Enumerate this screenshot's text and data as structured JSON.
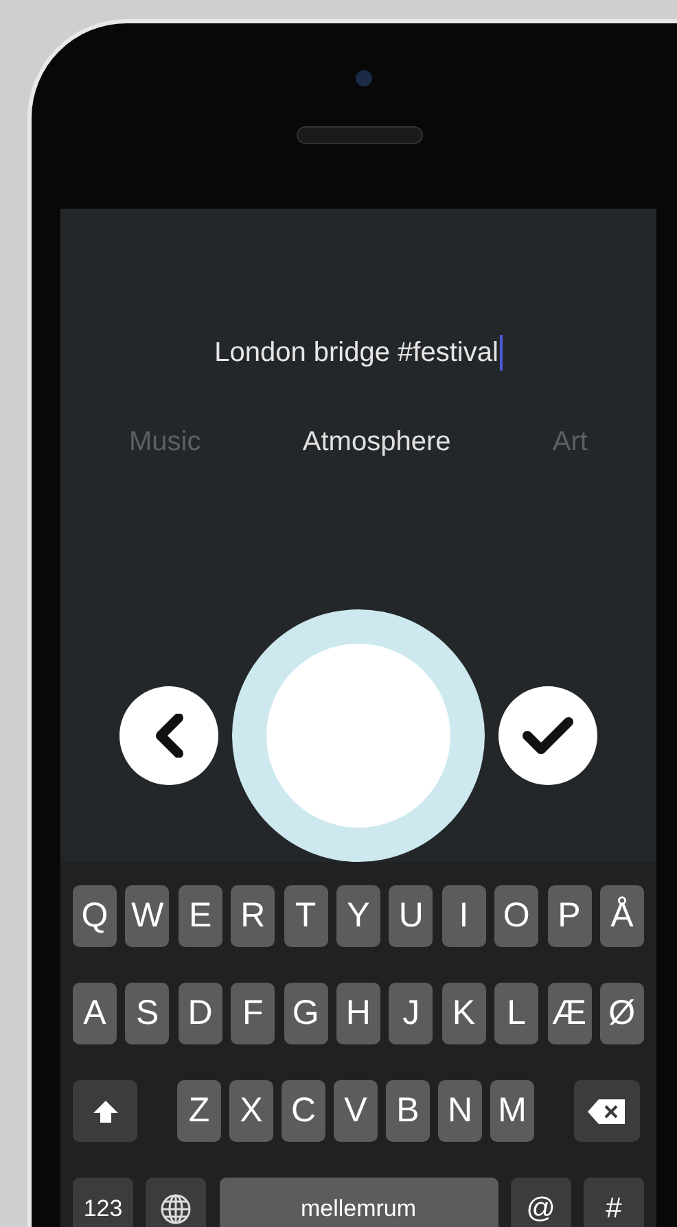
{
  "caption_field": {
    "value": "London bridge #festival",
    "focused": true
  },
  "categories": [
    {
      "label": "Music",
      "selected": false
    },
    {
      "label": "Atmosphere",
      "selected": true
    },
    {
      "label": "Art",
      "selected": false
    }
  ],
  "keyboard": {
    "rows": [
      {
        "keys": [
          {
            "kind": "letter",
            "label": "Q"
          },
          {
            "kind": "letter",
            "label": "W"
          },
          {
            "kind": "letter",
            "label": "E"
          },
          {
            "kind": "letter",
            "label": "R"
          },
          {
            "kind": "letter",
            "label": "T"
          },
          {
            "kind": "letter",
            "label": "Y"
          },
          {
            "kind": "letter",
            "label": "U"
          },
          {
            "kind": "letter",
            "label": "I"
          },
          {
            "kind": "letter",
            "label": "O"
          },
          {
            "kind": "letter",
            "label": "P"
          },
          {
            "kind": "letter",
            "label": "Å"
          }
        ]
      },
      {
        "keys": [
          {
            "kind": "letter",
            "label": "A"
          },
          {
            "kind": "letter",
            "label": "S"
          },
          {
            "kind": "letter",
            "label": "D"
          },
          {
            "kind": "letter",
            "label": "F"
          },
          {
            "kind": "letter",
            "label": "G"
          },
          {
            "kind": "letter",
            "label": "H"
          },
          {
            "kind": "letter",
            "label": "J"
          },
          {
            "kind": "letter",
            "label": "K"
          },
          {
            "kind": "letter",
            "label": "L"
          },
          {
            "kind": "letter",
            "label": "Æ"
          },
          {
            "kind": "letter",
            "label": "Ø"
          }
        ]
      },
      {
        "keys": [
          {
            "kind": "shift"
          },
          {
            "kind": "letter",
            "label": "Z"
          },
          {
            "kind": "letter",
            "label": "X"
          },
          {
            "kind": "letter",
            "label": "C"
          },
          {
            "kind": "letter",
            "label": "V"
          },
          {
            "kind": "letter",
            "label": "B"
          },
          {
            "kind": "letter",
            "label": "N"
          },
          {
            "kind": "letter",
            "label": "M"
          },
          {
            "kind": "backspace"
          }
        ]
      },
      {
        "keys": [
          {
            "kind": "numbers",
            "label": "123"
          },
          {
            "kind": "globe"
          },
          {
            "kind": "space",
            "label": "mellemrum"
          },
          {
            "kind": "symbol",
            "label": "@"
          },
          {
            "kind": "symbol",
            "label": "#"
          }
        ]
      }
    ]
  }
}
